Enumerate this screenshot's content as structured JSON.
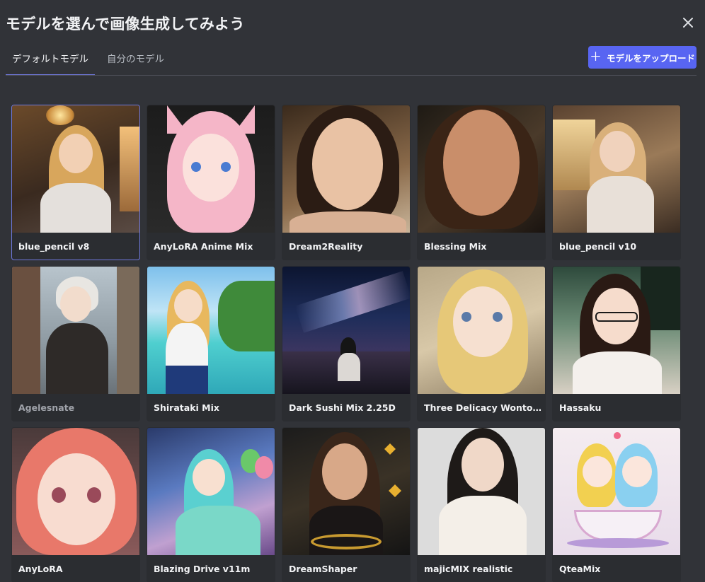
{
  "header": {
    "title": "モデルを選んで画像生成してみよう",
    "close_icon": "close-icon"
  },
  "tabs": [
    {
      "label": "デフォルトモデル",
      "active": true
    },
    {
      "label": "自分のモデル",
      "active": false
    }
  ],
  "upload_button": {
    "label": "モデルをアップロード",
    "icon": "plus-icon",
    "color": "#5865f2"
  },
  "models": [
    {
      "name": "blue_pencil v8",
      "selected": true
    },
    {
      "name": "AnyLoRA Anime Mix"
    },
    {
      "name": "Dream2Reality"
    },
    {
      "name": "Blessing Mix"
    },
    {
      "name": "blue_pencil v10"
    },
    {
      "name": "Agelesnate"
    },
    {
      "name": "Shirataki Mix"
    },
    {
      "name": "Dark Sushi Mix 2.25D"
    },
    {
      "name": "Three Delicacy Wonton ..."
    },
    {
      "name": "Hassaku"
    },
    {
      "name": "AnyLoRA"
    },
    {
      "name": "Blazing Drive v11m"
    },
    {
      "name": "DreamShaper"
    },
    {
      "name": "majicMIX realistic"
    },
    {
      "name": "QteaMix"
    }
  ]
}
